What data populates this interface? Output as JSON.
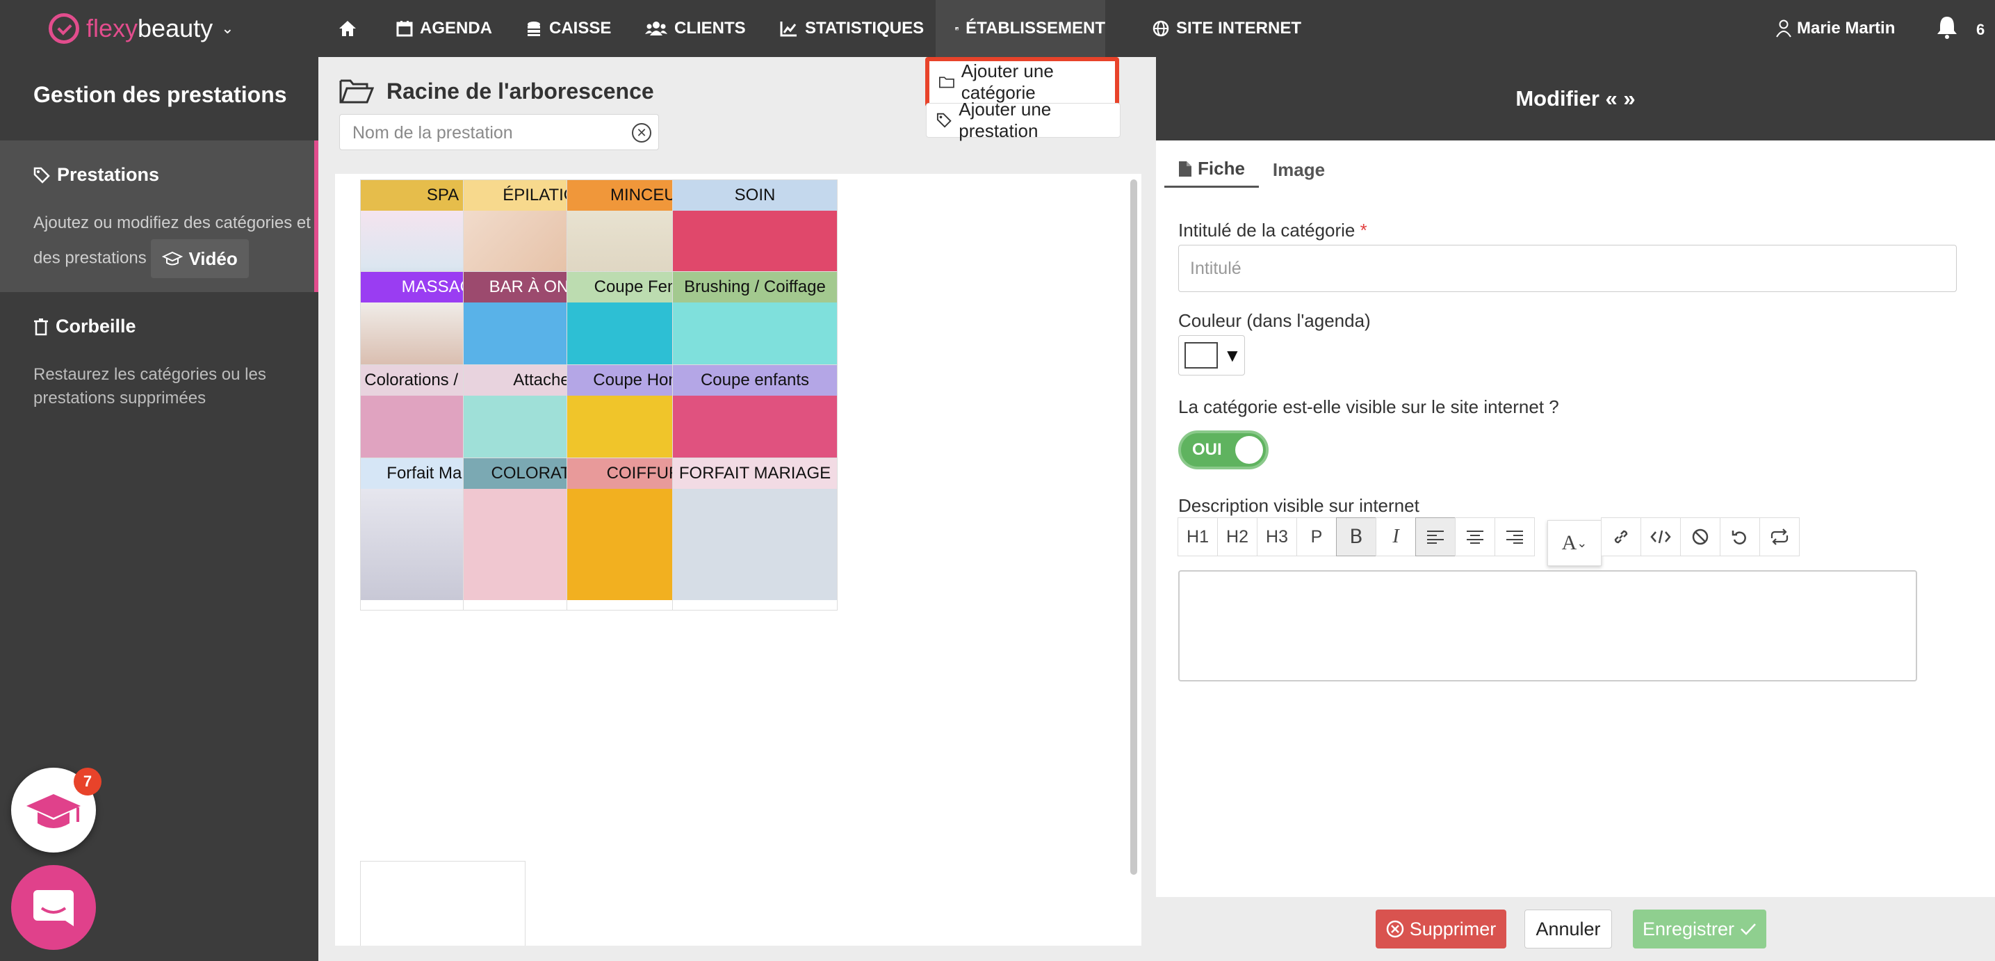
{
  "brand": {
    "part1": "flexy",
    "part2": "beauty",
    "logo_color": "#e24d8d"
  },
  "nav": {
    "items": [
      {
        "label": "",
        "icon": "home-icon"
      },
      {
        "label": "AGENDA",
        "icon": "calendar-icon"
      },
      {
        "label": "CAISSE",
        "icon": "coins-icon"
      },
      {
        "label": "CLIENTS",
        "icon": "users-icon"
      },
      {
        "label": "STATISTIQUES",
        "icon": "chart-icon"
      },
      {
        "label": "ÉTABLISSEMENT",
        "icon": "store-icon",
        "active": true
      },
      {
        "label": "SITE INTERNET",
        "icon": "globe-icon"
      }
    ],
    "user": "Marie Martin",
    "notifications": "6"
  },
  "sidebar": {
    "title": "Gestion des prestations",
    "prestations_label": "Prestations",
    "prestations_desc": "Ajoutez ou modifiez des catégories et des prestations",
    "video_label": "Vidéo",
    "corbeille_label": "Corbeille",
    "corbeille_desc": "Restaurez les catégories ou les prestations supprimées"
  },
  "center": {
    "root_title": "Racine de l'arborescence",
    "search_placeholder": "Nom de la prestation",
    "add_category": "Ajouter une catégorie",
    "add_prestation": "Ajouter une prestation",
    "categories": [
      {
        "label": "SPA",
        "color": "#e6bd4b"
      },
      {
        "label": "ÉPILATION",
        "color": "#f7d98d"
      },
      {
        "label": "MINCEUR",
        "color": "#f0973a"
      },
      {
        "label": "SOIN",
        "color": "#c4d8ed"
      },
      {
        "label": "MASSAGE",
        "color": "#9a3df2",
        "light": true
      },
      {
        "label": "BAR À ONGLE",
        "color": "#9c4a6e",
        "light": true
      },
      {
        "label": "Coupe Femme",
        "color": "#bcdcb0"
      },
      {
        "label": "Brushing / Coiffage",
        "color": "#a3c98f"
      },
      {
        "label": "Colorations / Mèches",
        "color": "#e8d3de"
      },
      {
        "label": "Attaches",
        "color": "#e8d3de"
      },
      {
        "label": "Coupe Homme",
        "color": "#b4a6e6"
      },
      {
        "label": "Coupe enfants",
        "color": "#b4a6e6"
      },
      {
        "label": "Forfait Mariage",
        "color": "#d6e6f6"
      },
      {
        "label": "COLORATION",
        "color": "#7ba9b3"
      },
      {
        "label": "COIFFURE",
        "color": "#e89a9a"
      },
      {
        "label": "FORFAIT MARIAGE",
        "color": "#f2dbe4"
      }
    ]
  },
  "panel": {
    "title": "Modifier « »",
    "tabs": [
      {
        "label": "Fiche",
        "icon": "file-icon"
      },
      {
        "label": "Image"
      }
    ],
    "intitule_label": "Intitulé de la catégorie",
    "required_mark": "*",
    "intitule_placeholder": "Intitulé",
    "couleur_label": "Couleur (dans l'agenda)",
    "visible_label": "La catégorie est-elle visible sur le site internet ?",
    "toggle_label": "OUI",
    "desc_label": "Description visible sur internet",
    "toolbar": [
      "H1",
      "H2",
      "H3",
      "P"
    ],
    "delete_label": "Supprimer",
    "cancel_label": "Annuler",
    "save_label": "Enregistrer"
  },
  "floaters": {
    "academy_badge": "7"
  }
}
